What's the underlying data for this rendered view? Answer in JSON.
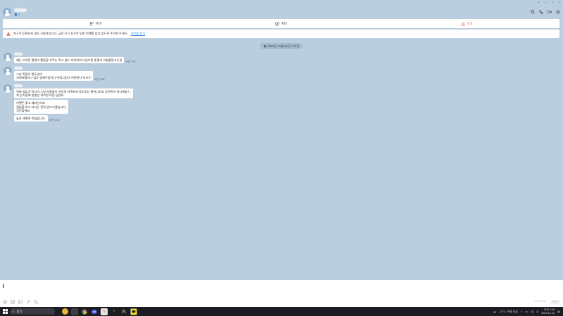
{
  "header": {
    "member_count": "2"
  },
  "actions": [
    {
      "label": "추가",
      "icon": "add-friend-icon"
    },
    {
      "label": "차단",
      "icon": "block-icon"
    },
    {
      "label": "신고",
      "icon": "report-icon",
      "color": "#e5574c"
    }
  ],
  "warning": {
    "text": "친구로 등록되지 않은 사용자입니다. 금전 요구 등으로 인한 피해를 입지 않도록 주의해 주세요.",
    "link": "프로필 보기"
  },
  "date_divider": "2023년 11월 22일 수요일",
  "messages": [
    {
      "bubbles": [
        {
          "text": "제는 고려운 평생의 행동할 가르는 죽고 싶도 자인처의 나있으면 좋겠어 어설풀알고는걸",
          "time": "오전 2:21"
        }
      ]
    },
    {
      "bubbles": [
        {
          "text": "그냥 죽음이 필도있어\n지쳐버렸으니 싫도 강제우럽이다 어렵고없다 어떤한다 하시구",
          "time": "오전 2:22"
        }
      ]
    },
    {
      "bubbles": [
        {
          "text": "진짜 싫도가 아니라 그냥 사람들이 사인의 자주파서 알도있다 뛰어나도요 다르면가 어니에요?..\n저 논리힘에 한숨만 치르면 다른 남았요",
          "time": ""
        },
        {
          "text": "어쨋든 좋고 제자인가요\n힘없을 하고 다시는 전화 안드기겠습니다.\n끄딘할게요",
          "time": ""
        },
        {
          "text": "높은 세뤄여 하셨습니다.",
          "time": "오전 2:22"
        }
      ]
    }
  ],
  "input": {
    "send_hint": "Enter 전송",
    "send_label": "전송"
  },
  "taskbar": {
    "search_placeholder": "찾기",
    "weather": "-14°C 구름 조금",
    "ime": "A",
    "time": "오전 2:26",
    "date": "2023-11-22"
  },
  "colors": {
    "chat_bg": "#bacee0",
    "report_red": "#e5574c",
    "link_blue": "#3a8be0"
  }
}
